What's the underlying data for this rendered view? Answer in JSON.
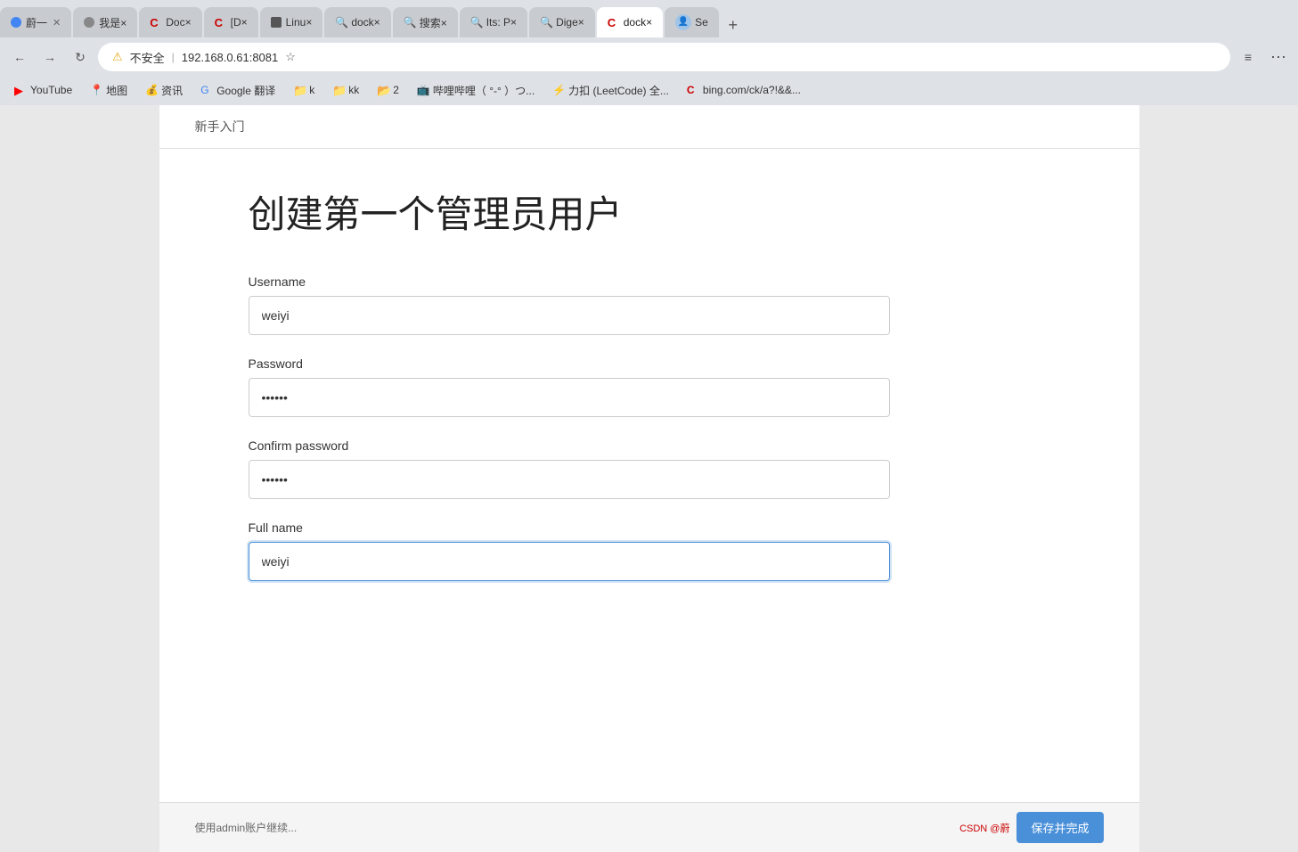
{
  "browser": {
    "tabs": [
      {
        "id": "tab1",
        "label": "蔚一",
        "active": false,
        "favicon": "circle"
      },
      {
        "id": "tab2",
        "label": "我是×",
        "active": false,
        "favicon": "circle"
      },
      {
        "id": "tab3",
        "label": "Doc×",
        "active": false,
        "favicon": "c-red"
      },
      {
        "id": "tab4",
        "label": "[D×",
        "active": false,
        "favicon": "c-red"
      },
      {
        "id": "tab5",
        "label": "Linu×",
        "active": false,
        "favicon": "circle"
      },
      {
        "id": "tab6",
        "label": "dock×",
        "active": false,
        "favicon": "search"
      },
      {
        "id": "tab7",
        "label": "搜索×",
        "active": false,
        "favicon": "search-blue"
      },
      {
        "id": "tab8",
        "label": "Its: P×",
        "active": false,
        "favicon": "search-green"
      },
      {
        "id": "tab9",
        "label": "Dige×",
        "active": false,
        "favicon": "search-green2"
      },
      {
        "id": "tab10",
        "label": "dock×",
        "active": true,
        "favicon": "c-red"
      },
      {
        "id": "tab11",
        "label": "Se",
        "active": false,
        "favicon": "avatar"
      }
    ],
    "address": {
      "warning_text": "不安全",
      "url": "192.168.0.61:8081"
    },
    "bookmarks": [
      {
        "id": "bm-youtube",
        "label": "YouTube",
        "icon": "yt"
      },
      {
        "id": "bm-maps",
        "label": "地图",
        "icon": "map"
      },
      {
        "id": "bm-news",
        "label": "资讯",
        "icon": "news"
      },
      {
        "id": "bm-translate",
        "label": "Google 翻译",
        "icon": "translate"
      },
      {
        "id": "bm-k",
        "label": "k",
        "icon": "folder-yellow"
      },
      {
        "id": "bm-kk",
        "label": "kk",
        "icon": "folder-yellow"
      },
      {
        "id": "bm-2",
        "label": "2",
        "icon": "folder-orange"
      },
      {
        "id": "bm-bilibili",
        "label": "哔哩哔哩（ °-° ）つ...",
        "icon": "bilibili"
      },
      {
        "id": "bm-leetcode",
        "label": "力扣 (LeetCode) 全...",
        "icon": "leetcode"
      },
      {
        "id": "bm-bing",
        "label": "bing.com/ck/a?!&&...",
        "icon": "bing"
      }
    ]
  },
  "page": {
    "breadcrumb": "新手入门",
    "title": "创建第一个管理员用户",
    "fields": {
      "username": {
        "label": "Username",
        "value": "weiyi",
        "type": "text"
      },
      "password": {
        "label": "Password",
        "value": "••••••",
        "type": "password",
        "dots": "••••••"
      },
      "confirm_password": {
        "label": "Confirm password",
        "value": "••••••",
        "type": "password",
        "dots": "••••••"
      },
      "full_name": {
        "label": "Full name",
        "value": "weiyi",
        "type": "text"
      }
    },
    "bottom": {
      "hint": "admin账户继续...",
      "save_label": "保存并完成"
    },
    "csdn": "CSDN @蔚"
  }
}
